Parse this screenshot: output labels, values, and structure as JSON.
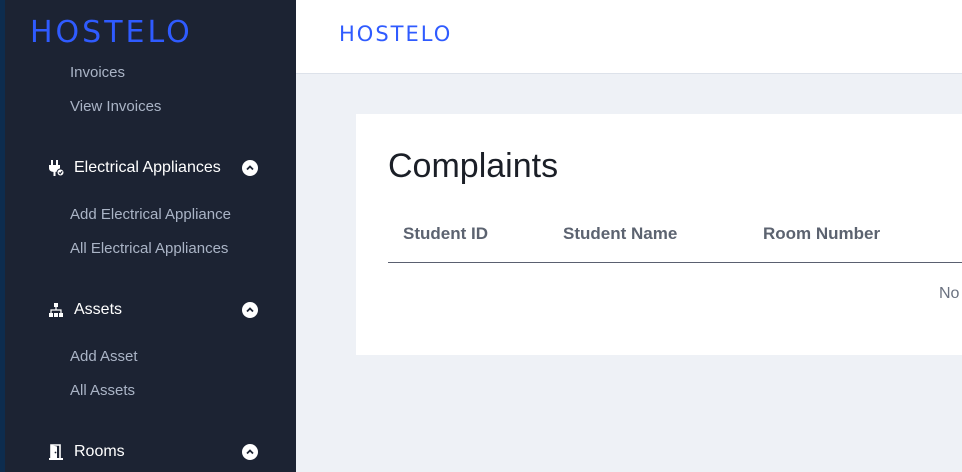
{
  "brand": {
    "name": "HOSTELO",
    "color": "#2f5bff"
  },
  "sidebar": {
    "invoices_group": {
      "items": [
        {
          "label": "Invoices"
        },
        {
          "label": "View Invoices"
        }
      ]
    },
    "groups": [
      {
        "label": "Electrical Appliances",
        "icon": "plug-icon",
        "expanded": true,
        "items": [
          {
            "label": "Add Electrical Appliance"
          },
          {
            "label": "All Electrical Appliances"
          }
        ]
      },
      {
        "label": "Assets",
        "icon": "sitemap-icon",
        "expanded": true,
        "items": [
          {
            "label": "Add Asset"
          },
          {
            "label": "All Assets"
          }
        ]
      },
      {
        "label": "Rooms",
        "icon": "door-icon",
        "expanded": true,
        "items": []
      }
    ]
  },
  "main": {
    "title": "Complaints",
    "table": {
      "columns": [
        "Student ID",
        "Student Name",
        "Room Number"
      ],
      "empty_text": "No"
    }
  }
}
